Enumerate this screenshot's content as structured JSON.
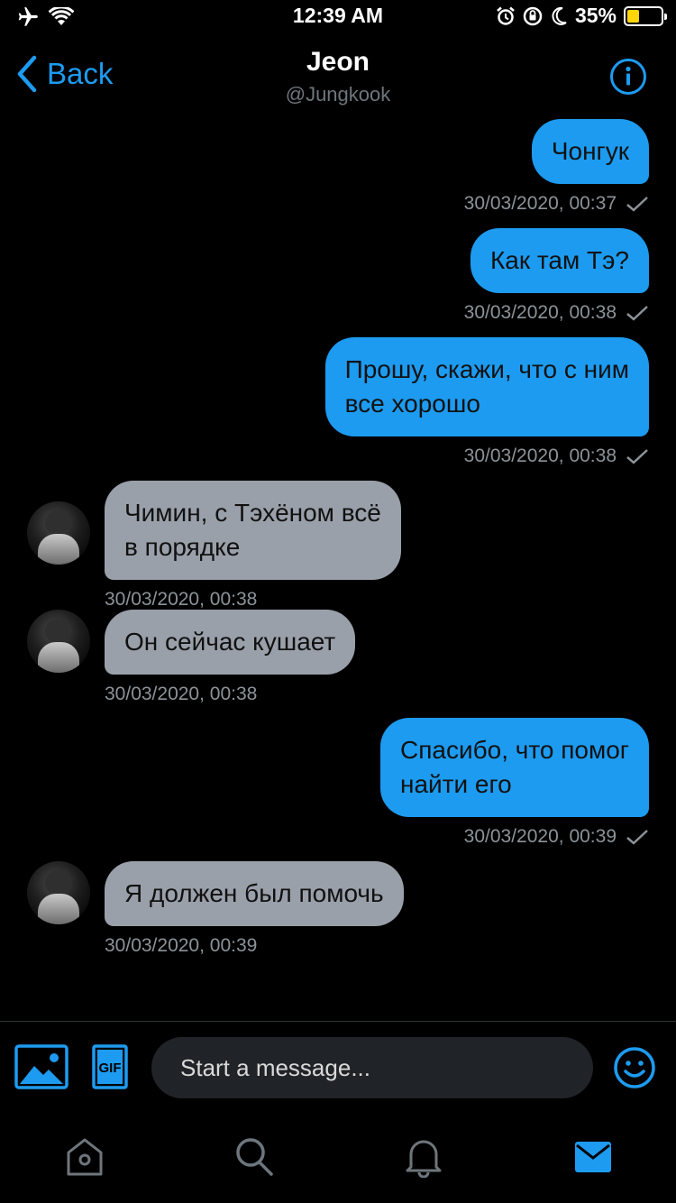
{
  "status_bar": {
    "time": "12:39 AM",
    "battery": "35%",
    "battery_level": 0.35,
    "icons": [
      "airplane-icon",
      "wifi-icon",
      "alarm-icon",
      "orientation-lock-icon",
      "moon-icon",
      "battery-icon"
    ]
  },
  "header": {
    "back_label": "Back",
    "title": "Jeon",
    "handle": "@Jungkook",
    "info_icon": "info-icon"
  },
  "messages": [
    {
      "direction": "sent",
      "lines": [
        "Чонгук"
      ],
      "timestamp": "30/03/2020, 00:37"
    },
    {
      "direction": "sent",
      "lines": [
        "Как там Тэ?"
      ],
      "timestamp": "30/03/2020, 00:38"
    },
    {
      "direction": "sent",
      "lines": [
        "Прошу, скажи, что с ним",
        "все хорошо"
      ],
      "timestamp": "30/03/2020, 00:38"
    },
    {
      "direction": "received",
      "lines": [
        "Чимин, с Тэхёном всё",
        "в порядке"
      ],
      "timestamp": "30/03/2020, 00:38"
    },
    {
      "direction": "received",
      "lines": [
        "Он сейчас кушает"
      ],
      "timestamp": "30/03/2020, 00:38"
    },
    {
      "direction": "sent",
      "lines": [
        "Спасибо, что помог",
        "найти его"
      ],
      "timestamp": "30/03/2020, 00:39"
    },
    {
      "direction": "received",
      "lines": [
        "Я должен был помочь"
      ],
      "timestamp": "30/03/2020, 00:39"
    }
  ],
  "composer": {
    "placeholder": "Start a message...",
    "gif_label": "GIF",
    "image_icon": "image-icon",
    "emoji_icon": "emoji-icon"
  },
  "tabbar": {
    "tabs": [
      "home-icon",
      "search-icon",
      "notifications-icon",
      "messages-icon"
    ],
    "active": "messages-icon"
  },
  "colors": {
    "accent": "#1d9bf0",
    "received_bubble": "#9aa0aa",
    "background": "#000000",
    "timestamp": "#8b9399",
    "battery": "#ffd60a"
  }
}
